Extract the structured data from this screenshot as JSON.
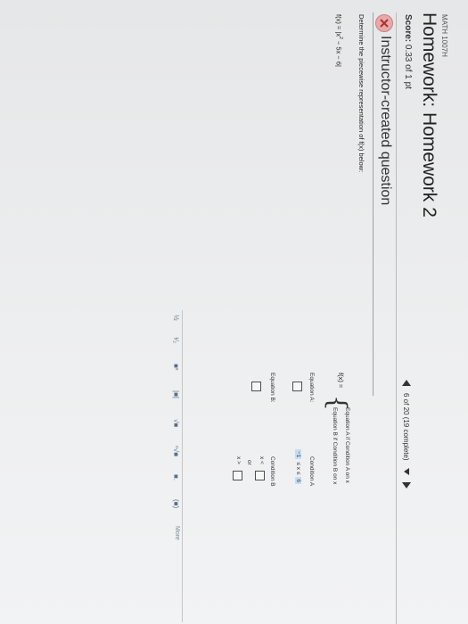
{
  "header": {
    "course": "MATH 1007H",
    "title": "Homework: Homework 2",
    "score_label": "Score:",
    "score_value": "0.33 of 1 pt",
    "nav_progress": "6 of 20 (19 complete)"
  },
  "question": {
    "title": "Instructor-created question",
    "icon": "x-circle-icon",
    "prompt": "Determine the piecewise representation of f(x) below:",
    "function_lhs": "f(x) = |x",
    "function_exp": "2",
    "function_rhs": " − 5x − 6|"
  },
  "piecewise": {
    "lhs": "f(x) =",
    "brace": "{",
    "line_a": "Equation A  if   Condition A on x",
    "line_b": "Equation B  if   Condition B on x"
  },
  "answers": {
    "equation_a_label": "Equation A:",
    "condition_a_label": "Condition A",
    "condition_a_lower": "−1",
    "condition_a_middle": "≤ x ≤",
    "condition_a_upper": "6",
    "equation_b_label": "Equation B:",
    "condition_b_label": "Condition B",
    "cond_b_lt": "x <",
    "cond_b_or": "or",
    "cond_b_gt": "x >"
  },
  "toolbar": {
    "fraction": "½",
    "mixed": "¹⁄₂",
    "power": "■ˣ",
    "abs": "|■|",
    "sqrt": "√■",
    "nthroot": "ⁿ√■",
    "subscript": "■.",
    "paren": "(■)",
    "more": "More"
  },
  "colors": {
    "accent": "#1c4f80",
    "chip_bg": "#c9dcef",
    "error_icon": "#e8a9a9"
  }
}
